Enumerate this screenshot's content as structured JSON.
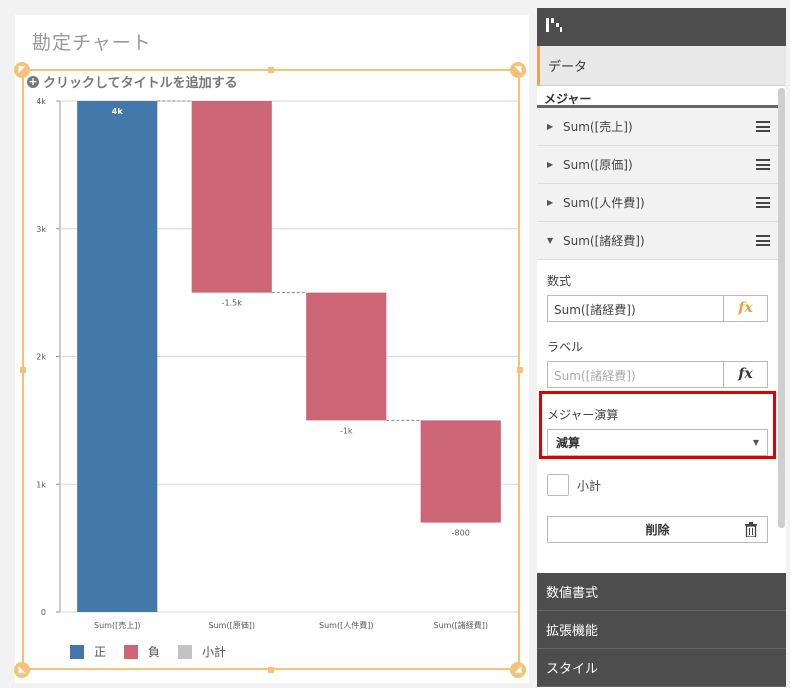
{
  "sheet": {
    "title": "勘定チャート",
    "add_title_text": "クリックしてタイトルを追加する"
  },
  "chart_data": {
    "type": "bar",
    "subtype": "waterfall",
    "categories": [
      "Sum([売上])",
      "Sum([原価])",
      "Sum([人件費])",
      "Sum([諸経費])"
    ],
    "values": [
      4000,
      -1500,
      -1000,
      -800
    ],
    "value_labels": [
      "4k",
      "-1.5k",
      "-1k",
      "-800"
    ],
    "measure_types": [
      "positive",
      "negative",
      "negative",
      "negative"
    ],
    "y_ticks": [
      {
        "value": 0,
        "label": "0"
      },
      {
        "value": 1000,
        "label": "1k"
      },
      {
        "value": 2000,
        "label": "2k"
      },
      {
        "value": 3000,
        "label": "3k"
      },
      {
        "value": 4000,
        "label": "4k"
      }
    ],
    "ylim": [
      0,
      4000
    ],
    "grid": true,
    "colors": {
      "positive": "#4477aa",
      "negative": "#cc6677",
      "subtotal": "#c3c3c3"
    },
    "legend": {
      "position": "bottom",
      "items": [
        {
          "label": "正",
          "color": "#4477aa"
        },
        {
          "label": "負",
          "color": "#cc6677"
        },
        {
          "label": "小計",
          "color": "#c3c3c3"
        }
      ]
    }
  },
  "panel": {
    "data_section": "データ",
    "measures_label": "メジャー",
    "measures": [
      {
        "label": "Sum([売上])",
        "expanded": false
      },
      {
        "label": "Sum([原価])",
        "expanded": false
      },
      {
        "label": "Sum([人件費])",
        "expanded": false
      },
      {
        "label": "Sum([諸経費])",
        "expanded": true
      }
    ],
    "detail": {
      "expression_label": "数式",
      "expression_value": "Sum([諸経費])",
      "fx": "fx",
      "label_label": "ラベル",
      "label_placeholder": "Sum([諸経費])",
      "agg_label": "メジャー演算",
      "agg_value": "減算",
      "subtotal_label": "小計",
      "delete_label": "削除"
    },
    "bottom_sections": [
      "数値書式",
      "拡張機能",
      "スタイル"
    ]
  }
}
